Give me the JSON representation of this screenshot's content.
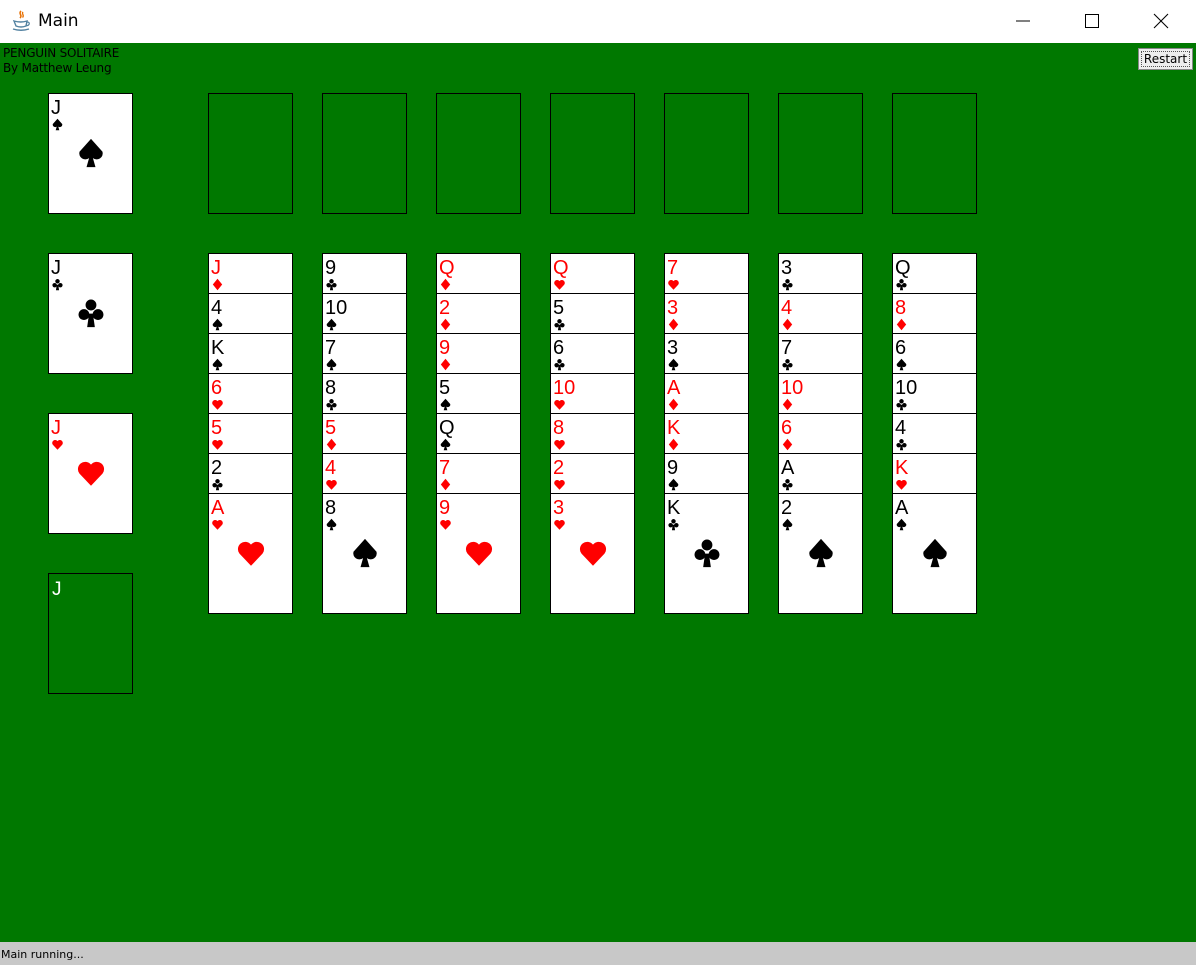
{
  "window": {
    "title": "Main"
  },
  "game": {
    "title_line1": "PENGUIN SOLITAIRE",
    "title_line2": "By Matthew Leung",
    "restart_label": "Restart"
  },
  "colors": {
    "felt": "#007800",
    "red_suit": "#ff0000",
    "black_suit": "#000000"
  },
  "foundations": [
    {
      "rank": "J",
      "suit": "spades"
    },
    {
      "rank": "J",
      "suit": "clubs"
    },
    {
      "rank": "J",
      "suit": "hearts"
    },
    {
      "rank": "J",
      "suit": null
    }
  ],
  "cells": [
    null,
    null,
    null,
    null,
    null,
    null,
    null
  ],
  "tableau": [
    [
      {
        "rank": "J",
        "suit": "diamonds"
      },
      {
        "rank": "4",
        "suit": "spades"
      },
      {
        "rank": "K",
        "suit": "spades"
      },
      {
        "rank": "6",
        "suit": "hearts"
      },
      {
        "rank": "5",
        "suit": "hearts"
      },
      {
        "rank": "2",
        "suit": "clubs"
      },
      {
        "rank": "A",
        "suit": "hearts"
      }
    ],
    [
      {
        "rank": "9",
        "suit": "clubs"
      },
      {
        "rank": "10",
        "suit": "spades"
      },
      {
        "rank": "7",
        "suit": "spades"
      },
      {
        "rank": "8",
        "suit": "clubs"
      },
      {
        "rank": "5",
        "suit": "diamonds"
      },
      {
        "rank": "4",
        "suit": "hearts"
      },
      {
        "rank": "8",
        "suit": "spades"
      }
    ],
    [
      {
        "rank": "Q",
        "suit": "diamonds"
      },
      {
        "rank": "2",
        "suit": "diamonds"
      },
      {
        "rank": "9",
        "suit": "diamonds"
      },
      {
        "rank": "5",
        "suit": "spades"
      },
      {
        "rank": "Q",
        "suit": "spades"
      },
      {
        "rank": "7",
        "suit": "diamonds"
      },
      {
        "rank": "9",
        "suit": "hearts"
      }
    ],
    [
      {
        "rank": "Q",
        "suit": "hearts"
      },
      {
        "rank": "5",
        "suit": "clubs"
      },
      {
        "rank": "6",
        "suit": "clubs"
      },
      {
        "rank": "10",
        "suit": "hearts"
      },
      {
        "rank": "8",
        "suit": "hearts"
      },
      {
        "rank": "2",
        "suit": "hearts"
      },
      {
        "rank": "3",
        "suit": "hearts"
      }
    ],
    [
      {
        "rank": "7",
        "suit": "hearts"
      },
      {
        "rank": "3",
        "suit": "diamonds"
      },
      {
        "rank": "3",
        "suit": "spades"
      },
      {
        "rank": "A",
        "suit": "diamonds"
      },
      {
        "rank": "K",
        "suit": "diamonds"
      },
      {
        "rank": "9",
        "suit": "spades"
      },
      {
        "rank": "K",
        "suit": "clubs"
      }
    ],
    [
      {
        "rank": "3",
        "suit": "clubs"
      },
      {
        "rank": "4",
        "suit": "diamonds"
      },
      {
        "rank": "7",
        "suit": "clubs"
      },
      {
        "rank": "10",
        "suit": "diamonds"
      },
      {
        "rank": "6",
        "suit": "diamonds"
      },
      {
        "rank": "A",
        "suit": "clubs"
      },
      {
        "rank": "2",
        "suit": "spades"
      }
    ],
    [
      {
        "rank": "Q",
        "suit": "clubs"
      },
      {
        "rank": "8",
        "suit": "diamonds"
      },
      {
        "rank": "6",
        "suit": "spades"
      },
      {
        "rank": "10",
        "suit": "clubs"
      },
      {
        "rank": "4",
        "suit": "clubs"
      },
      {
        "rank": "K",
        "suit": "hearts"
      },
      {
        "rank": "A",
        "suit": "spades"
      }
    ]
  ],
  "status": {
    "text": "Main running..."
  }
}
